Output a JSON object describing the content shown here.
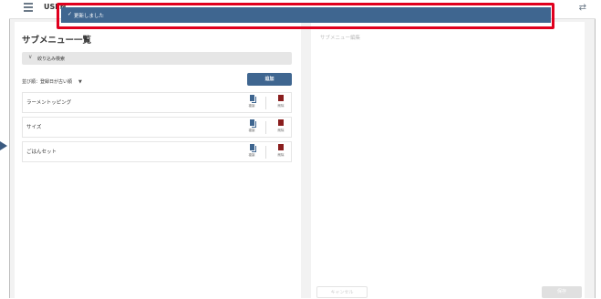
{
  "header": {
    "app_name": "USEN",
    "menu_icon": "hamburger-icon",
    "swap_icon": "swap-arrows-icon"
  },
  "toast": {
    "message": "更新しました",
    "icon": "check-icon",
    "background": "#3f6690",
    "highlight_color": "#e0001e"
  },
  "left_panel": {
    "title": "サブメニュー一覧",
    "filter_label": "絞り込み検索",
    "sort_label": "並び順：",
    "sort_value": "登録日が古い順",
    "add_label": "追加",
    "items": [
      {
        "name": "ラーメントッピング",
        "copy_label": "複製",
        "delete_label": "削除"
      },
      {
        "name": "サイズ",
        "copy_label": "複製",
        "delete_label": "削除"
      },
      {
        "name": "ごはんセット",
        "copy_label": "複製",
        "delete_label": "削除"
      }
    ]
  },
  "right_panel": {
    "title": "サブメニュー編集",
    "cancel_label": "キャンセル",
    "save_label": "保存"
  },
  "colors": {
    "accent": "#3f6690",
    "delete": "#8a1e1e"
  }
}
